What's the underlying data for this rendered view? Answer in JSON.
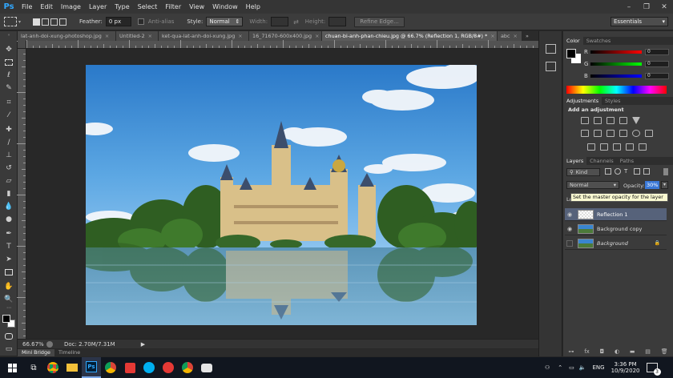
{
  "app": {
    "logo": "Ps",
    "accent": "#31a8ff"
  },
  "menu": [
    "File",
    "Edit",
    "Image",
    "Layer",
    "Type",
    "Select",
    "Filter",
    "View",
    "Window",
    "Help"
  ],
  "window_controls": {
    "minimize": "–",
    "restore": "❐",
    "close": "✕"
  },
  "options": {
    "feather_label": "Feather:",
    "feather_value": "0 px",
    "antialias_label": "Anti-alias",
    "style_label": "Style:",
    "style_value": "Normal",
    "width_label": "Width:",
    "height_label": "Height:",
    "refine_edge": "Refine Edge...",
    "workspace": "Essentials"
  },
  "tabs": [
    {
      "label": "lat-anh-doi-xung-photoshop.jpg",
      "active": false
    },
    {
      "label": "Untitled-2",
      "active": false
    },
    {
      "label": "ket-qua-lat-anh-doi-xung.jpg",
      "active": false
    },
    {
      "label": "16_71670-600x400.jpg",
      "active": false
    },
    {
      "label": "chuan-bi-anh-phan-chieu.jpg @ 66.7% (Reflection 1, RGB/8#) *",
      "active": true
    },
    {
      "label": "abc",
      "active": false
    }
  ],
  "tab_close": "×",
  "tab_overflow": "»",
  "status": {
    "zoom": "66.67%",
    "doc": "Doc: 2.70M/7.31M"
  },
  "bottom_tabs": [
    "Mini Bridge",
    "Timeline"
  ],
  "color_panel": {
    "tabs": [
      "Color",
      "Swatches"
    ],
    "channels": [
      {
        "label": "R",
        "value": "0"
      },
      {
        "label": "G",
        "value": "0"
      },
      {
        "label": "B",
        "value": "0"
      }
    ]
  },
  "adjustments_panel": {
    "tabs": [
      "Adjustments",
      "Styles"
    ],
    "title": "Add an adjustment"
  },
  "layers_panel": {
    "tabs": [
      "Layers",
      "Channels",
      "Paths"
    ],
    "kind_label": "Kind",
    "blend_mode": "Normal",
    "opacity_label": "Opacity:",
    "opacity_value": "30%",
    "lock_label": "Lo",
    "tooltip": "Set the master opacity for the layer",
    "layers": [
      {
        "name": "Reflection 1",
        "active": true,
        "visible": true
      },
      {
        "name": "Background copy",
        "active": false,
        "visible": true
      },
      {
        "name": "Background",
        "active": false,
        "visible": false,
        "locked": true
      }
    ]
  },
  "taskbar": {
    "time": "3:36 PM",
    "date": "10/9/2020",
    "lang": "ENG",
    "notification_badge": "3"
  }
}
